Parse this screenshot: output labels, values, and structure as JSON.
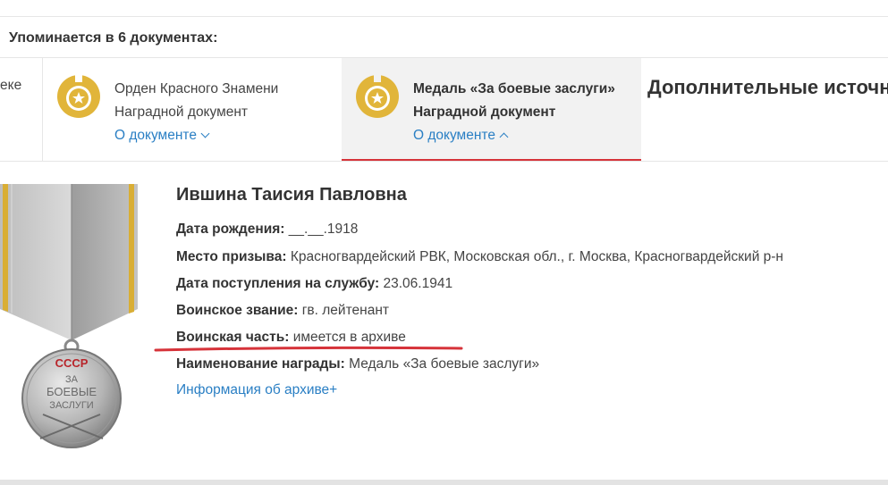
{
  "mentions": {
    "title": "Упоминается в 6 документах:"
  },
  "docs": {
    "partial_text": "еке",
    "cards": [
      {
        "title": "Орден Красного Знамени",
        "type": "Наградной документ",
        "link": "О документе"
      },
      {
        "title": "Медаль «За боевые заслуги»",
        "type": "Наградной документ",
        "link": "О документе"
      }
    ],
    "extra_sources": "Дополнительные источн"
  },
  "person": {
    "name": "Ившина Таисия Павловна",
    "fields": [
      {
        "label": "Дата рождения:",
        "value": "__.__.1918"
      },
      {
        "label": "Место призыва:",
        "value": "Красногвардейский РВК, Московская обл., г. Москва, Красногвардейский р-н"
      },
      {
        "label": "Дата поступления на службу:",
        "value": "23.06.1941"
      },
      {
        "label": "Воинское звание:",
        "value": "гв. лейтенант"
      },
      {
        "label": "Воинская часть:",
        "value": "имеется в архиве"
      },
      {
        "label": "Наименование награды:",
        "value": "Медаль «За боевые заслуги»"
      }
    ],
    "archive_link": "Информация об архиве+"
  },
  "medal_image": {
    "text_top": "СССР",
    "text_line1": "ЗА",
    "text_line2": "БОЕВЫЕ",
    "text_line3": "ЗАСЛУГИ"
  },
  "colors": {
    "accent_red": "#d6333a",
    "link_blue": "#2a7fc4",
    "badge_gold": "#e1b53a",
    "selected_bg": "#f2f2f2"
  }
}
